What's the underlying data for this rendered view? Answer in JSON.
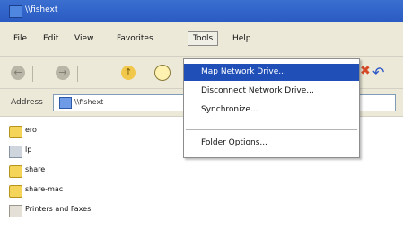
{
  "window": {
    "title": "\\\\fishext"
  },
  "menubar": {
    "items": [
      "File",
      "Edit",
      "View",
      "Favorites",
      "Tools",
      "Help"
    ],
    "active": "Tools"
  },
  "toolbar": {
    "icons": [
      "back-arrow-icon",
      "forward-arrow-icon",
      "up-folder-icon",
      "search-icon",
      "close-icon",
      "undo-icon"
    ]
  },
  "address": {
    "label": "Address",
    "value": "\\\\fishext"
  },
  "files": [
    {
      "name": "ero",
      "icon": "network-drive-icon"
    },
    {
      "name": "lp",
      "icon": "printer-icon"
    },
    {
      "name": "share",
      "icon": "network-drive-icon"
    },
    {
      "name": "share-mac",
      "icon": "network-drive-icon"
    },
    {
      "name": "Printers and Faxes",
      "icon": "printers-and-faxes-icon"
    }
  ],
  "tools_menu": {
    "items": [
      "Map Network Drive...",
      "Disconnect Network Drive...",
      "Synchronize...",
      "Folder Options..."
    ],
    "highlighted": "Map Network Drive..."
  },
  "colors": {
    "titlebar": "#2a5bc2",
    "menu_highlight": "#1f4fb7",
    "chrome": "#ece9d8"
  }
}
